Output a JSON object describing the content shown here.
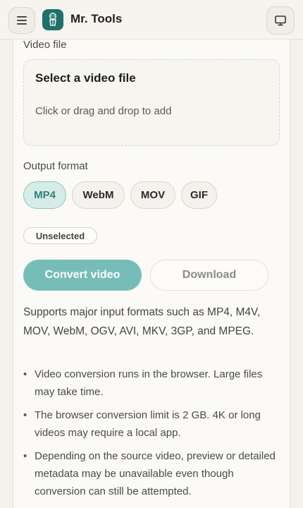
{
  "header": {
    "menu_icon": "hamburger-icon",
    "brand": "Mr. Tools",
    "logo_icon": "mascot-icon",
    "display_icon": "monitor-icon"
  },
  "video_file": {
    "label": "Video file",
    "dropzone_title": "Select a video file",
    "dropzone_hint": "Click or drag and drop to add"
  },
  "output_format": {
    "label": "Output format",
    "options": [
      "MP4",
      "WebM",
      "MOV",
      "GIF"
    ],
    "selected": "MP4"
  },
  "status_badge": "Unselected",
  "actions": {
    "convert": "Convert video",
    "download": "Download"
  },
  "description": "Supports major input formats such as MP4, M4V, MOV, WebM, OGV, AVI, MKV, 3GP, and MPEG.",
  "notes": [
    "Video conversion runs in the browser. Large files may take time.",
    "The browser conversion limit is 2 GB. 4K or long videos may require a local app.",
    "Depending on the source video, preview or detailed metadata may be unavailable even though conversion can still be attempted."
  ],
  "colors": {
    "accent": "#76bdb8",
    "accent_dark": "#2c8279",
    "logo": "#1f6f6b"
  }
}
